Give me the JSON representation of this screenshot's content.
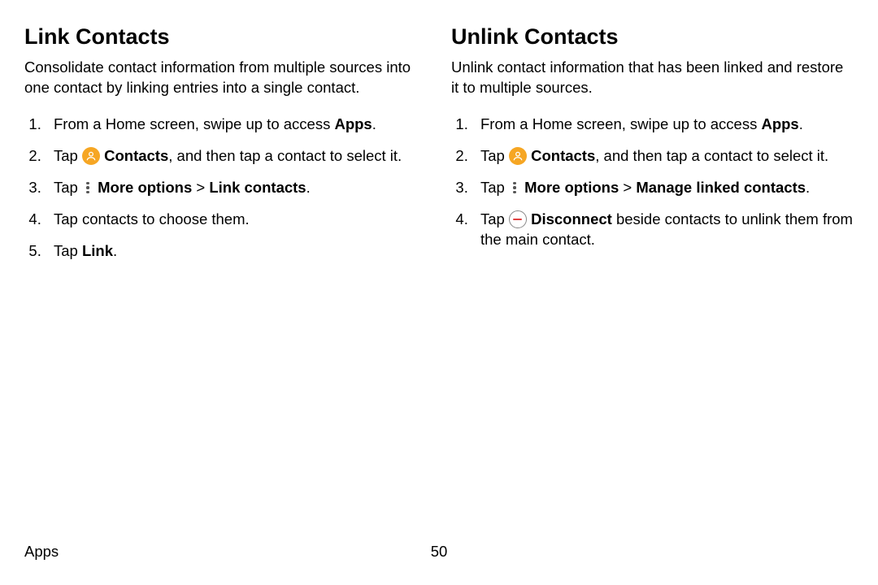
{
  "left": {
    "heading": "Link Contacts",
    "intro": "Consolidate contact information from multiple sources into one contact by linking entries into a single contact.",
    "step1_a": "From a Home screen, swipe up to access ",
    "step1_b": "Apps",
    "step1_c": ".",
    "step2_a": "Tap ",
    "step2_b": " Contacts",
    "step2_c": ", and then tap a contact to select it.",
    "step3_a": "Tap ",
    "step3_b": " More options",
    "step3_c": " > ",
    "step3_d": "Link contacts",
    "step3_e": ".",
    "step4": "Tap contacts to choose them.",
    "step5_a": "Tap ",
    "step5_b": "Link",
    "step5_c": "."
  },
  "right": {
    "heading": "Unlink Contacts",
    "intro": "Unlink contact information that has been linked and restore it to multiple sources.",
    "step1_a": "From a Home screen, swipe up to access ",
    "step1_b": "Apps",
    "step1_c": ".",
    "step2_a": "Tap ",
    "step2_b": " Contacts",
    "step2_c": ", and then tap a contact to select it.",
    "step3_a": "Tap ",
    "step3_b": " More options",
    "step3_c": " > ",
    "step3_d": "Manage linked contacts",
    "step3_e": ".",
    "step4_a": "Tap ",
    "step4_b": " Disconnect",
    "step4_c": " beside contacts to unlink them from the main contact."
  },
  "footer": {
    "section": "Apps",
    "page": "50"
  }
}
